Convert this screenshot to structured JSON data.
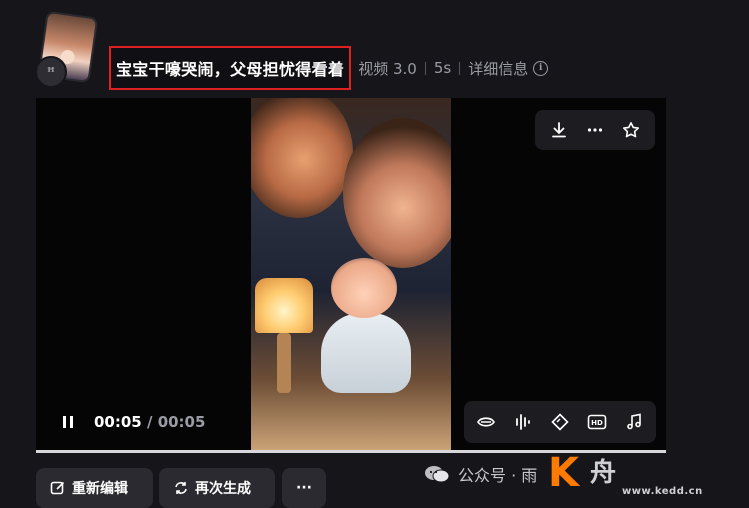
{
  "header": {
    "title": "宝宝干嚎哭闹，父母担忧得看着",
    "model": "视频 3.0",
    "duration": "5s",
    "details_label": "详细信息"
  },
  "player": {
    "current_time": "00:05",
    "total_time": "00:05",
    "progress": 1.0
  },
  "top_toolbar": {
    "icons": [
      "download-icon",
      "more-icon",
      "star-icon"
    ]
  },
  "bottom_toolbar": {
    "icons": [
      "lip-sync-icon",
      "audio-wave-icon",
      "frame-icon",
      "hd-icon",
      "music-icon"
    ],
    "hd_text": "HD"
  },
  "actions": {
    "re_edit_label": "重新编辑",
    "regenerate_label": "再次生成",
    "more_label": "···"
  },
  "watermark": {
    "text": "公众号 · 雨",
    "logo_letter": "K",
    "logo_text": "舟",
    "logo_url": "www.kedd.cn"
  },
  "colors": {
    "background": "#16161a",
    "highlight_border": "#e02020",
    "accent_logo": "#ff7a00"
  }
}
